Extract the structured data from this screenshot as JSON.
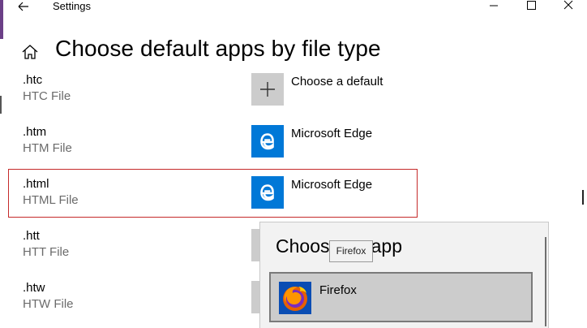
{
  "window": {
    "title": "Settings"
  },
  "header": {
    "title": "Choose default apps by file type"
  },
  "rows": [
    {
      "ext": ".htc",
      "desc": "HTC File",
      "app": "Choose a default",
      "icon": "plus-icon"
    },
    {
      "ext": ".htm",
      "desc": "HTM File",
      "app": "Microsoft Edge",
      "icon": "edge-icon"
    },
    {
      "ext": ".html",
      "desc": "HTML File",
      "app": "Microsoft Edge",
      "icon": "edge-icon"
    },
    {
      "ext": ".htt",
      "desc": "HTT File",
      "app": "",
      "icon": ""
    },
    {
      "ext": ".htw",
      "desc": "HTW File",
      "app": "",
      "icon": ""
    }
  ],
  "flyout": {
    "title": "Choose an app",
    "items": [
      {
        "label": "Firefox",
        "icon": "firefox-icon"
      }
    ],
    "tooltip": "Firefox"
  },
  "colors": {
    "accent_blue": "#0078d7",
    "selected_border": "#c52a2a",
    "flyout_bg": "#f2f2f2",
    "item_bg": "#cccccc"
  }
}
